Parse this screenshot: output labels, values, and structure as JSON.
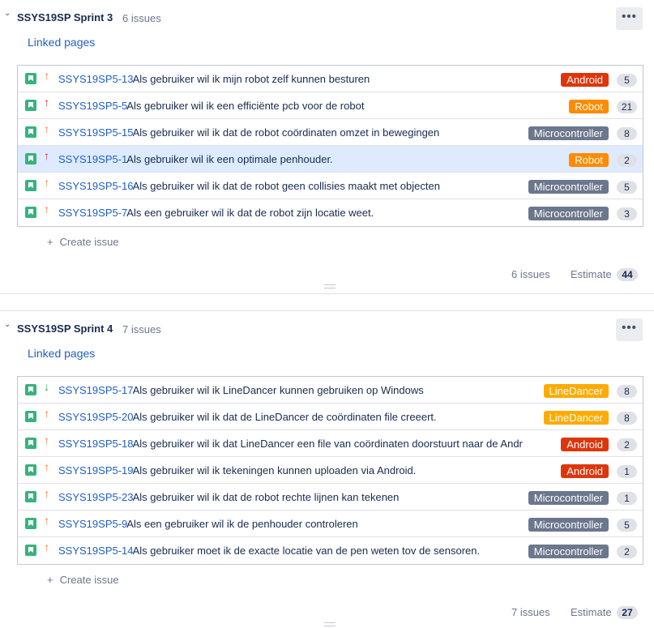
{
  "sprints": [
    {
      "title": "SSYS19SP Sprint 3",
      "count": "6 issues",
      "more": "•••",
      "linked": "Linked pages",
      "issues": [
        {
          "key": "SSYS19SP5-13",
          "summary": "Als gebruiker wil ik mijn robot zelf kunnen besturen",
          "priority": "medium",
          "arrow": "↑",
          "epic": "Android",
          "epic_color": "#de350b",
          "points": "5",
          "selected": false
        },
        {
          "key": "SSYS19SP5-5",
          "summary": "Als gebruiker wil ik een efficiënte pcb voor de robot",
          "priority": "high",
          "arrow": "↑",
          "epic": "Robot",
          "epic_color": "#ff8b00",
          "points": "21",
          "selected": false
        },
        {
          "key": "SSYS19SP5-15",
          "summary": "Als gebruiker wil ik dat de robot coördinaten omzet in bewegingen",
          "priority": "medium",
          "arrow": "↑",
          "epic": "Microcontroller",
          "epic_color": "#6b778c",
          "points": "8",
          "selected": false
        },
        {
          "key": "SSYS19SP5-1",
          "summary": "Als gebruiker wil ik een optimale penhouder.",
          "priority": "high",
          "arrow": "↑",
          "epic": "Robot",
          "epic_color": "#ff8b00",
          "points": "2",
          "selected": true
        },
        {
          "key": "SSYS19SP5-16",
          "summary": "Als gebruiker wil ik dat de robot geen collisies maakt met objecten",
          "priority": "medium",
          "arrow": "↑",
          "epic": "Microcontroller",
          "epic_color": "#6b778c",
          "points": "5",
          "selected": false
        },
        {
          "key": "SSYS19SP5-7",
          "summary": "Als een gebruiker wil ik dat de robot zijn locatie weet.",
          "priority": "medium",
          "arrow": "↑",
          "epic": "Microcontroller",
          "epic_color": "#6b778c",
          "points": "3",
          "selected": false
        }
      ],
      "create": "Create issue",
      "footer_count": "6 issues",
      "estimate_label": "Estimate",
      "estimate": "44"
    },
    {
      "title": "SSYS19SP Sprint 4",
      "count": "7 issues",
      "more": "•••",
      "linked": "Linked pages",
      "issues": [
        {
          "key": "SSYS19SP5-17",
          "summary": "Als gebruiker wil ik LineDancer kunnen gebruiken op Windows",
          "priority": "low",
          "arrow": "↓",
          "epic": "LineDancer",
          "epic_color": "#ffab00",
          "points": "8",
          "selected": false
        },
        {
          "key": "SSYS19SP5-20",
          "summary": "Als gebruiker wil ik dat de LineDancer de coördinaten file creeert.",
          "priority": "medium",
          "arrow": "↑",
          "epic": "LineDancer",
          "epic_color": "#ffab00",
          "points": "8",
          "selected": false
        },
        {
          "key": "SSYS19SP5-18",
          "summary": "Als gebruiker wil ik dat LineDancer een file van coördinaten doorstuurt naar de Andr",
          "priority": "medium",
          "arrow": "↑",
          "epic": "Android",
          "epic_color": "#de350b",
          "points": "2",
          "selected": false
        },
        {
          "key": "SSYS19SP5-19",
          "summary": "Als gebruiker wil ik tekeningen kunnen uploaden via Android.",
          "priority": "medium",
          "arrow": "↑",
          "epic": "Android",
          "epic_color": "#de350b",
          "points": "1",
          "selected": false
        },
        {
          "key": "SSYS19SP5-23",
          "summary": "Als gebruiker wil ik dat de robot rechte lijnen kan tekenen",
          "priority": "medium",
          "arrow": "↑",
          "epic": "Microcontroller",
          "epic_color": "#6b778c",
          "points": "1",
          "selected": false
        },
        {
          "key": "SSYS19SP5-9",
          "summary": "Als een gebruiker wil ik de penhouder controleren",
          "priority": "medium",
          "arrow": "↑",
          "epic": "Microcontroller",
          "epic_color": "#6b778c",
          "points": "5",
          "selected": false
        },
        {
          "key": "SSYS19SP5-14",
          "summary": "Als gebruiker moet ik de exacte locatie van de pen weten tov de sensoren.",
          "priority": "medium",
          "arrow": "↑",
          "epic": "Microcontroller",
          "epic_color": "#6b778c",
          "points": "2",
          "selected": false
        }
      ],
      "create": "Create issue",
      "footer_count": "7 issues",
      "estimate_label": "Estimate",
      "estimate": "27"
    }
  ],
  "icons": {
    "chevron": "chevron-down-icon",
    "story": "story-icon",
    "priority": "priority-icon",
    "more": "more-icon",
    "plus": "plus-icon"
  }
}
